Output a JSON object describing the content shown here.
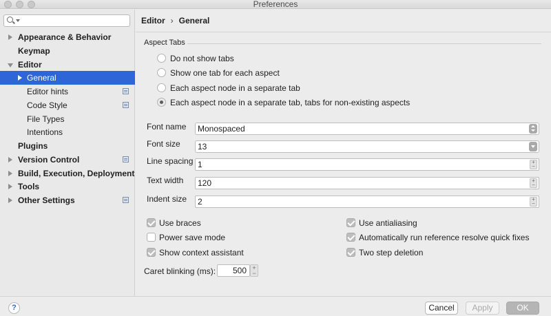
{
  "window": {
    "title": "Preferences"
  },
  "search": {
    "placeholder": "",
    "value": ""
  },
  "sidebar": {
    "items": [
      {
        "label": "Appearance & Behavior"
      },
      {
        "label": "Keymap"
      },
      {
        "label": "Editor"
      },
      {
        "label": "General"
      },
      {
        "label": "Editor hints"
      },
      {
        "label": "Code Style"
      },
      {
        "label": "File Types"
      },
      {
        "label": "Intentions"
      },
      {
        "label": "Plugins"
      },
      {
        "label": "Version Control"
      },
      {
        "label": "Build, Execution, Deployment"
      },
      {
        "label": "Tools"
      },
      {
        "label": "Other Settings"
      }
    ],
    "selected": "General"
  },
  "breadcrumb": {
    "parent": "Editor",
    "separator": "›",
    "current": "General"
  },
  "aspect_tabs": {
    "title": "Aspect Tabs",
    "options": [
      {
        "label": "Do not show tabs",
        "selected": false
      },
      {
        "label": "Show one tab for each aspect",
        "selected": false
      },
      {
        "label": "Each aspect node in a separate tab",
        "selected": false
      },
      {
        "label": "Each aspect node in a separate tab, tabs for non-existing aspects",
        "selected": true
      }
    ]
  },
  "fields": {
    "font_name": {
      "label": "Font name",
      "value": "Monospaced"
    },
    "font_size": {
      "label": "Font size",
      "value": "13"
    },
    "line_spacing": {
      "label": "Line spacing",
      "value": "1"
    },
    "text_width": {
      "label": "Text width",
      "value": "120"
    },
    "indent_size": {
      "label": "Indent size",
      "value": "2"
    }
  },
  "checkboxes": {
    "use_braces": {
      "label": "Use braces",
      "checked": true
    },
    "power_save_mode": {
      "label": "Power save mode",
      "checked": false
    },
    "show_context_assistant": {
      "label": "Show context assistant",
      "checked": true
    },
    "use_antialiasing": {
      "label": "Use antialiasing",
      "checked": true
    },
    "auto_run_quick_fixes": {
      "label": "Automatically run reference resolve quick fixes",
      "checked": true
    },
    "two_step_deletion": {
      "label": "Two step deletion",
      "checked": true
    }
  },
  "caret_blinking": {
    "label": "Caret blinking (ms):",
    "value": "500"
  },
  "footer": {
    "help": "?",
    "cancel": "Cancel",
    "apply": "Apply",
    "ok": "OK"
  },
  "colors": {
    "selection": "#2e66d8",
    "panel": "#ececec",
    "sidebar": "#e9e9e9"
  }
}
